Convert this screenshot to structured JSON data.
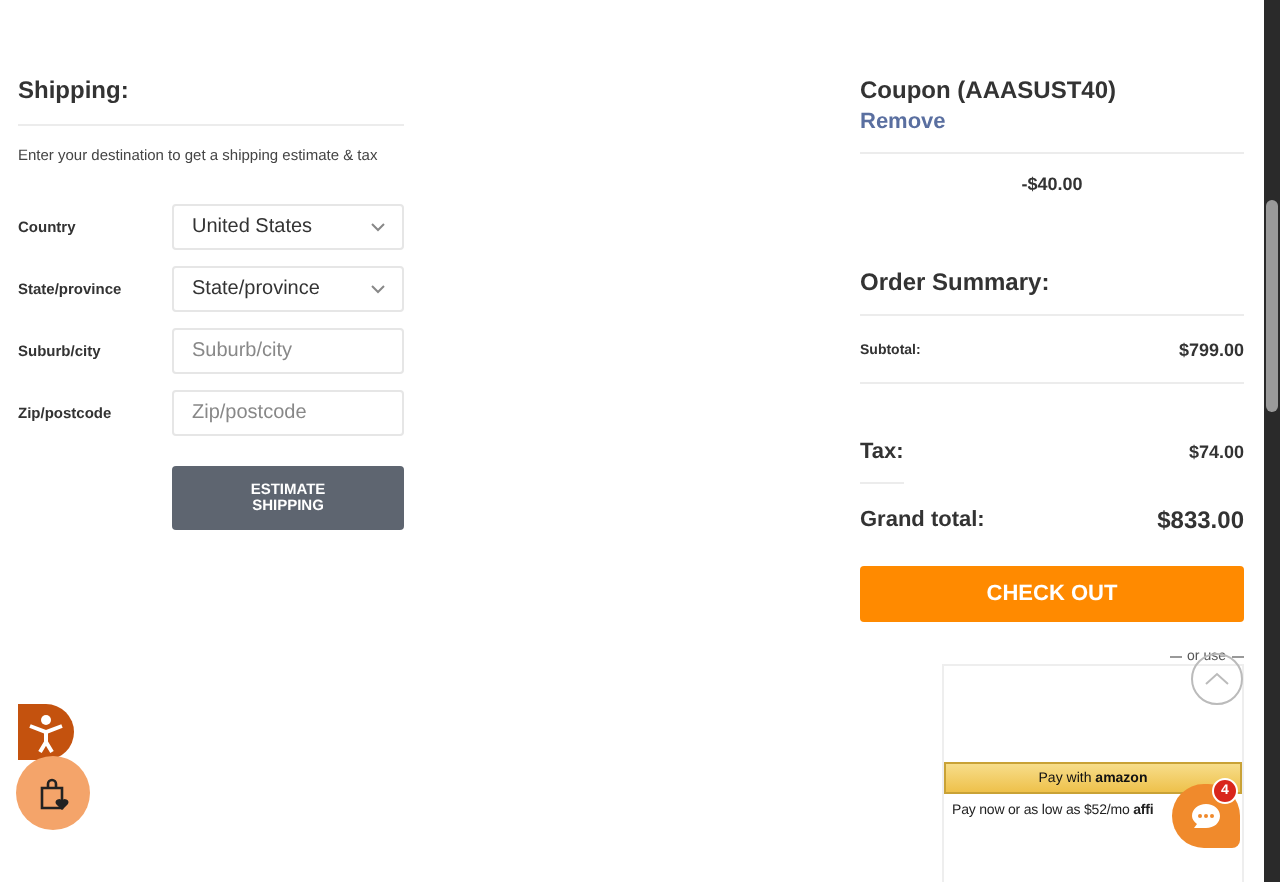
{
  "shipping": {
    "title": "Shipping:",
    "hint": "Enter your destination to get a shipping estimate & tax",
    "fields": [
      {
        "label": "Country",
        "kind": "select",
        "value": "United States"
      },
      {
        "label": "State/province",
        "kind": "select",
        "value": "State/province"
      },
      {
        "label": "Suburb/city",
        "kind": "input",
        "placeholder": "Suburb/city"
      },
      {
        "label": "Zip/postcode",
        "kind": "input",
        "placeholder": "Zip/postcode"
      }
    ],
    "button": "ESTIMATE SHIPPING"
  },
  "coupon": {
    "title": "Coupon (AAASUST40)",
    "remove": "Remove",
    "amount": "-$40.00"
  },
  "summary": {
    "title": "Order Summary:",
    "rows": [
      {
        "kind": "small",
        "label": "Subtotal:",
        "value": "$799.00"
      },
      {
        "kind": "tax",
        "label": "Tax:",
        "value": "$74.00"
      },
      {
        "kind": "total",
        "label": "Grand total:",
        "value": "$833.00"
      }
    ],
    "checkout": "CHECK OUT",
    "or_use": "or use",
    "amazon": "Pay with **amazon**",
    "affirm": "Pay now or as low as $52/mo **affi**"
  },
  "chat": {
    "badge": "4"
  }
}
